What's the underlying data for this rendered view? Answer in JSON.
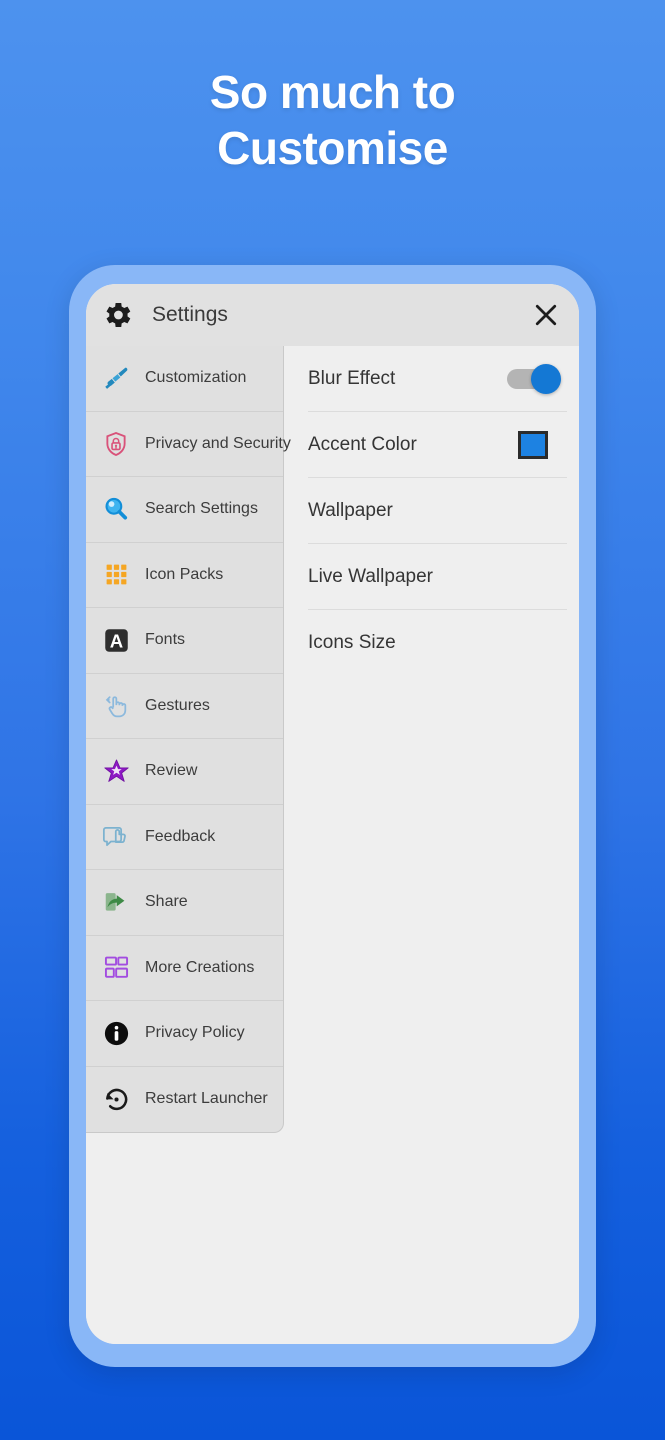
{
  "headline": {
    "line1": "So much to",
    "line2": "Customise"
  },
  "colors": {
    "background_top": "#4d92ed",
    "background_bottom": "#0a55d8",
    "phone_bezel": "#89b7f7",
    "screen": "#efefef",
    "titlebar": "#e1e1e1",
    "sidebar": "#e0e0e0",
    "accent": "#1d82e2",
    "toggle_on": "#1478d4"
  },
  "titlebar": {
    "gear_icon": "gear-icon",
    "title": "Settings",
    "close_icon": "close-icon"
  },
  "sidebar": {
    "items": [
      {
        "label": "Customization",
        "icon": "paintbrush-icon",
        "color": "#2389bd"
      },
      {
        "label": "Privacy and Security",
        "icon": "shield-lock-icon",
        "color": "#d9527a"
      },
      {
        "label": "Search Settings",
        "icon": "magnifier-icon",
        "color": "#19a3e8"
      },
      {
        "label": "Icon Packs",
        "icon": "grid-icon",
        "color": "#f5a623"
      },
      {
        "label": "Fonts",
        "icon": "letter-a-icon",
        "color": "#2e2e2e"
      },
      {
        "label": "Gestures",
        "icon": "hand-gesture-icon",
        "color": "#8cb9dd"
      },
      {
        "label": "Review",
        "icon": "star-icon",
        "color": "#8e18c4"
      },
      {
        "label": "Feedback",
        "icon": "thumbs-up-icon",
        "color": "#7cb2cf"
      },
      {
        "label": "Share",
        "icon": "share-arrow-icon",
        "color": "#5f9162"
      },
      {
        "label": "More Creations",
        "icon": "layout-blocks-icon",
        "color": "#a24ce0"
      },
      {
        "label": "Privacy Policy",
        "icon": "info-circle-icon",
        "color": "#0d0d0d"
      },
      {
        "label": "Restart Launcher",
        "icon": "restart-icon",
        "color": "#1a1a1a"
      }
    ]
  },
  "panel": {
    "rows": [
      {
        "label": "Blur Effect",
        "control": "toggle",
        "value": "on"
      },
      {
        "label": "Accent Color",
        "control": "swatch",
        "value": "#1d82e2"
      },
      {
        "label": "Wallpaper",
        "control": "none",
        "value": ""
      },
      {
        "label": "Live Wallpaper",
        "control": "none",
        "value": ""
      },
      {
        "label": "Icons Size",
        "control": "none",
        "value": ""
      }
    ]
  }
}
